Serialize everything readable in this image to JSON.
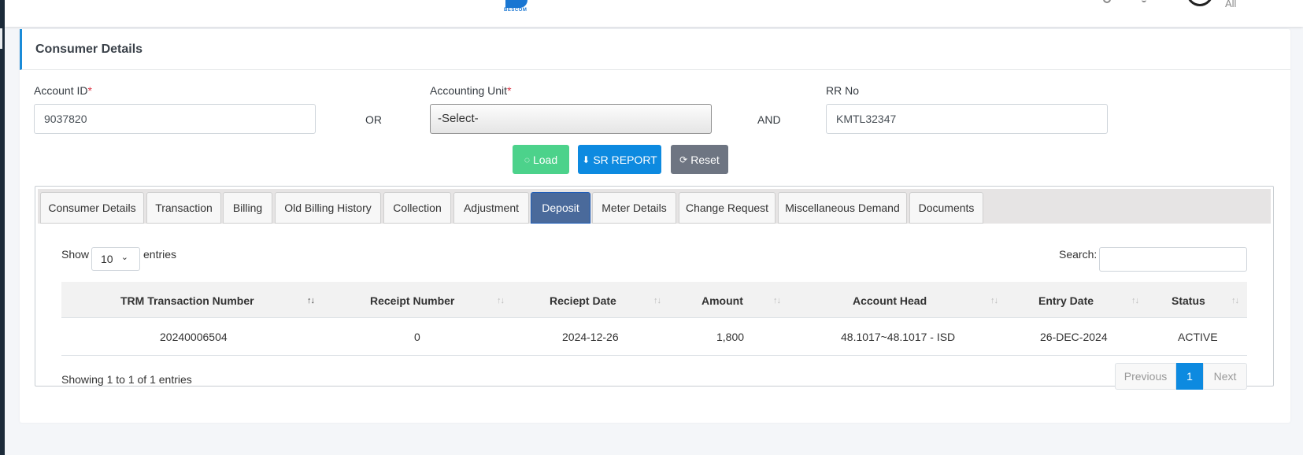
{
  "header": {
    "logo_text": "BESCOM",
    "all_label": "All"
  },
  "card": {
    "title": "Consumer Details"
  },
  "form": {
    "account_id_label": "Account ID",
    "account_id_value": "9037820",
    "or_label": "OR",
    "accounting_unit_label": "Accounting Unit",
    "accounting_unit_value": "-Select-",
    "and_label": "AND",
    "rr_no_label": "RR No",
    "rr_no_value": "KMTL32347",
    "required_mark": "*"
  },
  "buttons": {
    "load": "Load",
    "sr_report": "SR REPORT",
    "reset": "Reset"
  },
  "tabs": [
    {
      "label": "Consumer Details"
    },
    {
      "label": "Transaction"
    },
    {
      "label": "Billing"
    },
    {
      "label": "Old Billing History"
    },
    {
      "label": "Collection"
    },
    {
      "label": "Adjustment"
    },
    {
      "label": "Deposit",
      "active": true
    },
    {
      "label": "Meter Details"
    },
    {
      "label": "Change Request"
    },
    {
      "label": "Miscellaneous Demand"
    },
    {
      "label": "Documents"
    }
  ],
  "table": {
    "show_label": "Show",
    "page_length": "10",
    "entries_label": "entries",
    "search_label": "Search:",
    "columns": [
      "TRM Transaction Number",
      "Receipt Number",
      "Reciept Date",
      "Amount",
      "Account Head",
      "Entry Date",
      "Status"
    ],
    "rows": [
      [
        "20240006504",
        "0",
        "2024-12-26",
        "1,800",
        "48.1017~48.1017 - ISD",
        "26-DEC-2024",
        "ACTIVE"
      ]
    ],
    "info": "Showing 1 to 1 of 1 entries",
    "pagination": {
      "previous": "Previous",
      "current": "1",
      "next": "Next"
    }
  }
}
